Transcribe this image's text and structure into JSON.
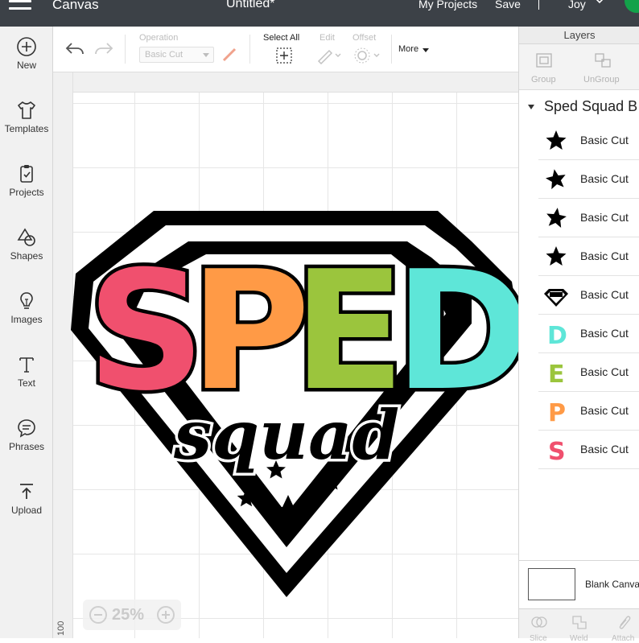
{
  "topbar": {
    "app_title": "Canvas",
    "doc_title": "Untitled*",
    "my_projects": "My Projects",
    "save": "Save",
    "divider": "|",
    "user": "Joy"
  },
  "leftnav": [
    {
      "label": "New",
      "icon": "plus-circle-icon"
    },
    {
      "label": "Templates",
      "icon": "tshirt-icon"
    },
    {
      "label": "Projects",
      "icon": "projects-icon"
    },
    {
      "label": "Shapes",
      "icon": "shapes-icon"
    },
    {
      "label": "Images",
      "icon": "lightbulb-icon"
    },
    {
      "label": "Text",
      "icon": "text-icon"
    },
    {
      "label": "Phrases",
      "icon": "speech-bubble-icon"
    },
    {
      "label": "Upload",
      "icon": "upload-icon"
    }
  ],
  "toolbar": {
    "operation_label": "Operation",
    "operation_value": "Basic Cut",
    "select_all": "Select All",
    "edit": "Edit",
    "offset": "Offset",
    "more": "More"
  },
  "canvas": {
    "ruler_value": "100",
    "zoom": "25%",
    "design": {
      "letters": [
        {
          "char": "S",
          "color": "#f0506e"
        },
        {
          "char": "P",
          "color": "#ff9a46"
        },
        {
          "char": "E",
          "color": "#9bc53d"
        },
        {
          "char": "D",
          "color": "#5ee6d8"
        }
      ],
      "script": "squad"
    }
  },
  "layers": {
    "title": "Layers",
    "group_btn": "Group",
    "ungroup_btn": "UnGroup",
    "group_name": "Sped Squad B",
    "items": [
      {
        "label": "Basic Cut",
        "thumb": "star"
      },
      {
        "label": "Basic Cut",
        "thumb": "star"
      },
      {
        "label": "Basic Cut",
        "thumb": "star"
      },
      {
        "label": "Basic Cut",
        "thumb": "star"
      },
      {
        "label": "Basic Cut",
        "thumb": "badge"
      },
      {
        "label": "Basic Cut",
        "thumb": "letter-d",
        "glyph": "D",
        "color": "#5ee6d8"
      },
      {
        "label": "Basic Cut",
        "thumb": "letter-e",
        "glyph": "E",
        "color": "#9bc53d"
      },
      {
        "label": "Basic Cut",
        "thumb": "letter-p",
        "glyph": "P",
        "color": "#ff9a46"
      },
      {
        "label": "Basic Cut",
        "thumb": "letter-s",
        "glyph": "S",
        "color": "#f0506e"
      }
    ],
    "blank_canvas": "Blank Canvas",
    "bottom": [
      "Slice",
      "Weld",
      "Attach"
    ]
  }
}
